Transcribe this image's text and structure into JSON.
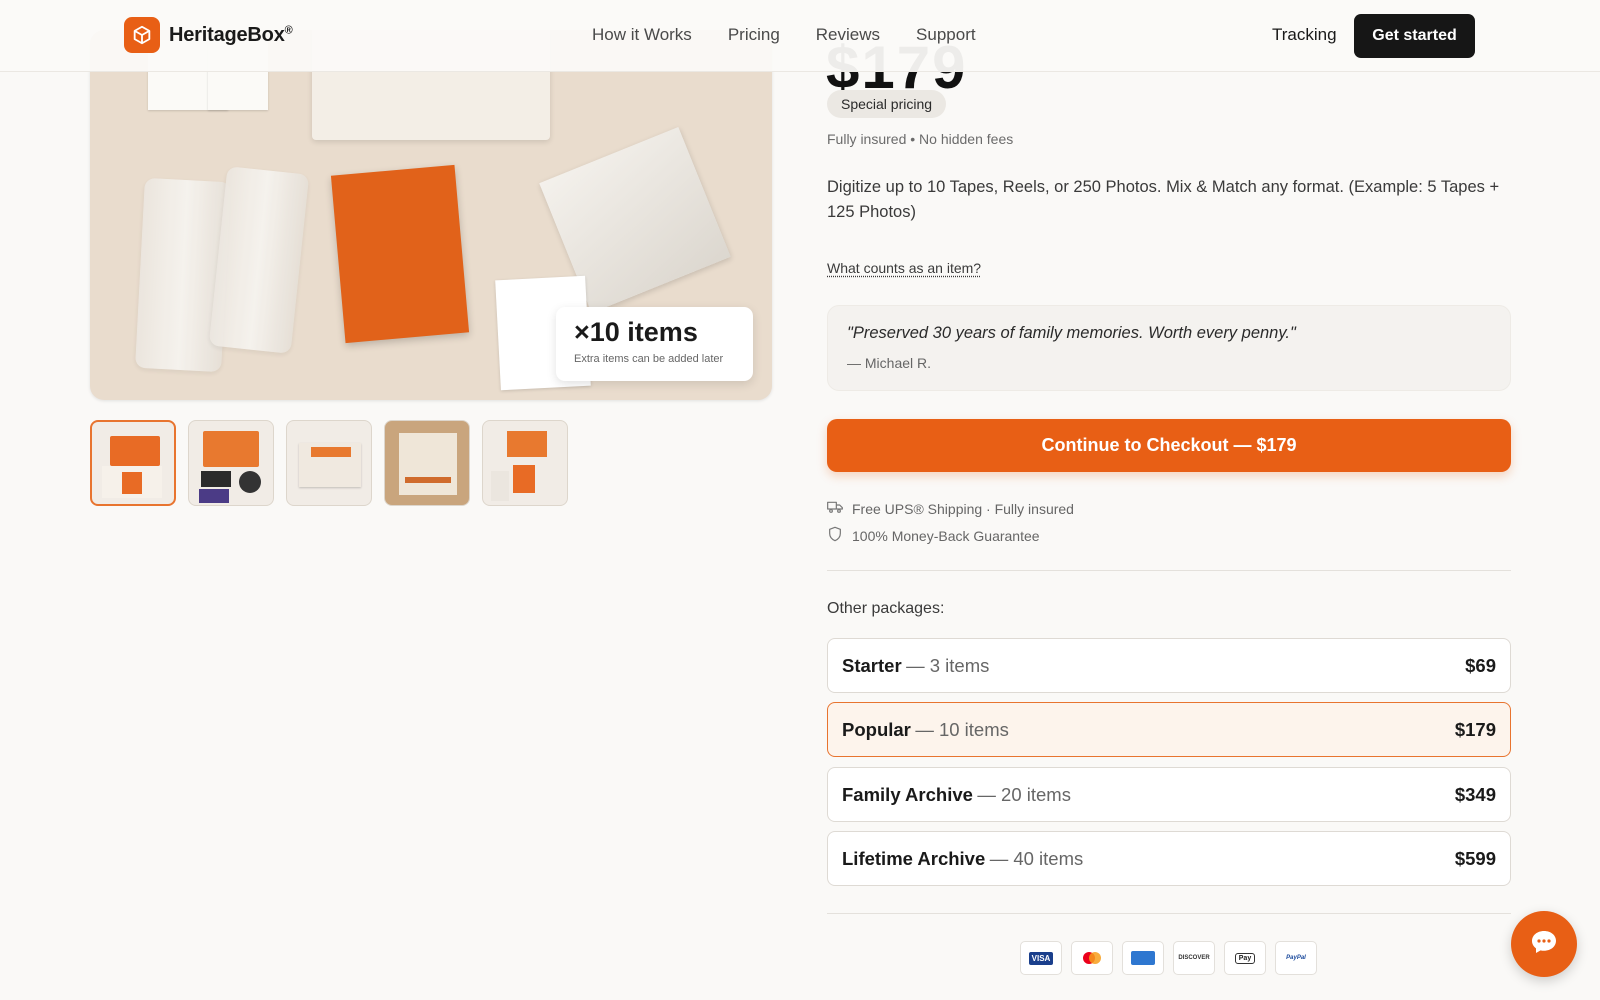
{
  "brand": {
    "name": "HeritageBox",
    "mark": "®",
    "logo_icon": "box-icon",
    "accent": "#e85f15"
  },
  "nav": {
    "items": [
      "How it Works",
      "Pricing",
      "Reviews",
      "Support"
    ],
    "tracking": "Tracking",
    "cta": "Get started"
  },
  "gallery": {
    "badge_count": "×10 items",
    "badge_note": "Extra items can be added later",
    "thumbnails": 5,
    "active_index": 0
  },
  "product": {
    "price": "$179",
    "special_badge": "Special pricing",
    "insured_note": "Fully insured • No hidden fees",
    "description": "Digitize up to 10 Tapes, Reels, or 250 Photos. Mix & Match any format. (Example: 5 Tapes + 125 Photos)",
    "what_counts_link": "What counts as an item?",
    "testimonial": {
      "quote": "\"Preserved 30 years of family memories. Worth every penny.\"",
      "author": "— Michael R."
    },
    "checkout_label": "Continue to Checkout — $179",
    "perks": [
      {
        "icon": "truck-icon",
        "text": "Free UPS® Shipping · Fully insured"
      },
      {
        "icon": "shield-icon",
        "text": "100% Money-Back Guarantee"
      }
    ]
  },
  "packages": {
    "label": "Other packages:",
    "items": [
      {
        "name": "Starter",
        "count": "— 3 items",
        "price": "$69",
        "selected": false
      },
      {
        "name": "Popular",
        "count": "— 10 items",
        "price": "$179",
        "selected": true
      },
      {
        "name": "Family Archive",
        "count": "— 20 items",
        "price": "$349",
        "selected": false
      },
      {
        "name": "Lifetime Archive",
        "count": "— 40 items",
        "price": "$599",
        "selected": false
      }
    ]
  },
  "payments": [
    "VISA",
    "mastercard",
    "amex",
    "DISCOVER",
    "Pay",
    "PayPal"
  ],
  "chat": {
    "icon": "chat-bubble-icon"
  }
}
